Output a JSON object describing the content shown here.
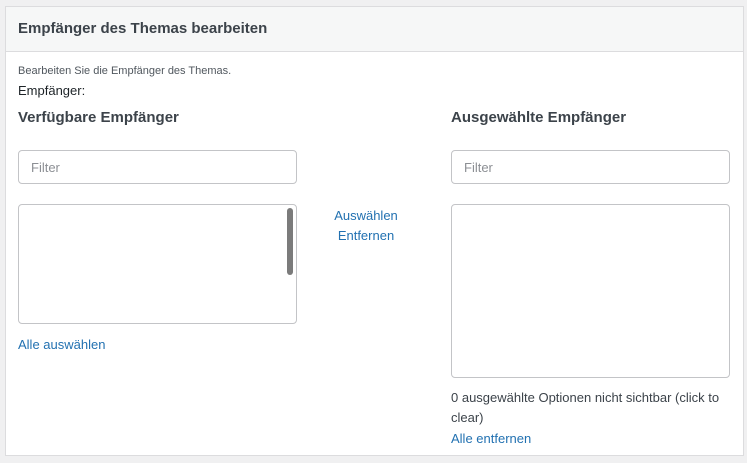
{
  "header": {
    "title": "Empfänger des Themas bearbeiten"
  },
  "description": "Bearbeiten Sie die Empfänger des Themas.",
  "field_label": "Empfänger:",
  "available": {
    "heading": "Verfügbare Empfänger",
    "filter_placeholder": "Filter",
    "select_all_label": "Alle auswählen"
  },
  "actions": {
    "select_label": "Auswählen",
    "remove_label": "Entfernen"
  },
  "selected": {
    "heading": "Ausgewählte Empfänger",
    "filter_placeholder": "Filter",
    "hidden_note": "0 ausgewählte Optionen nicht sichtbar (click to clear)",
    "remove_all_label": "Alle entfernen"
  },
  "colors": {
    "link": "#2271b1",
    "header_bg": "#f6f7f7",
    "border": "#c3c4c7"
  }
}
